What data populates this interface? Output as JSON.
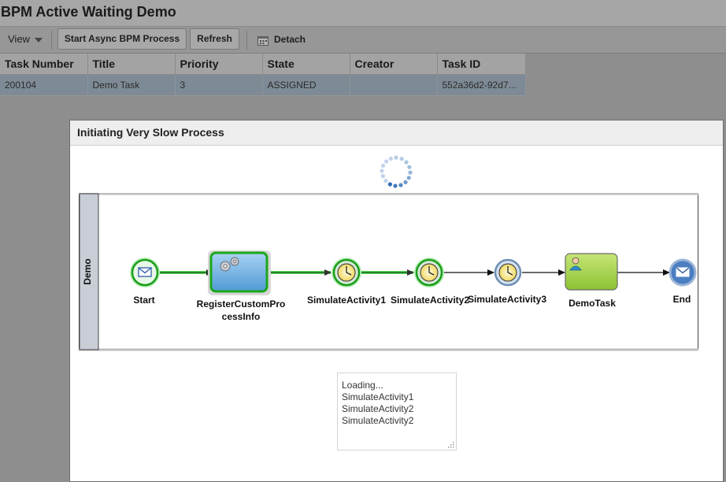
{
  "app": {
    "title": "BPM Active Waiting Demo"
  },
  "toolbar": {
    "view_label": "View",
    "start_button": "Start Async BPM Process",
    "refresh_button": "Refresh",
    "detach_label": "Detach"
  },
  "table": {
    "columns": [
      "Task Number",
      "Title",
      "Priority",
      "State",
      "Creator",
      "Task ID"
    ],
    "rows": [
      [
        "200104",
        "Demo Task",
        "3",
        "ASSIGNED",
        "",
        "552a36d2-92d7..."
      ]
    ]
  },
  "dialog": {
    "title": "Initiating Very Slow Process",
    "lane_label": "Demo",
    "nodes": {
      "start": "Start",
      "register_line1": "RegisterCustomPro",
      "register_line2": "cessInfo",
      "sim1": "SimulateActivity1",
      "sim2": "SimulateActivity2",
      "sim3": "SimulateActivity3",
      "demotask": "DemoTask",
      "end": "End"
    },
    "log_lines": [
      "Loading...",
      "SimulateActivity1",
      "SimulateActivity2",
      "SimulateActivity2"
    ]
  },
  "colors": {
    "active_green": "#22cc22",
    "task_blue": "#6aaee0",
    "human_task_green": "#a6d24a",
    "lane_header": "#c8cdd6",
    "spinner_blue": "#2f6db5"
  },
  "icons": {
    "view_caret": "chevron-down-icon",
    "detach": "detach-window-icon",
    "start_event": "envelope-icon",
    "service_task": "gears-icon",
    "timer": "clock-icon",
    "human_task": "user-icon",
    "end_event": "envelope-filled-icon",
    "spinner": "loading-spinner-icon"
  }
}
